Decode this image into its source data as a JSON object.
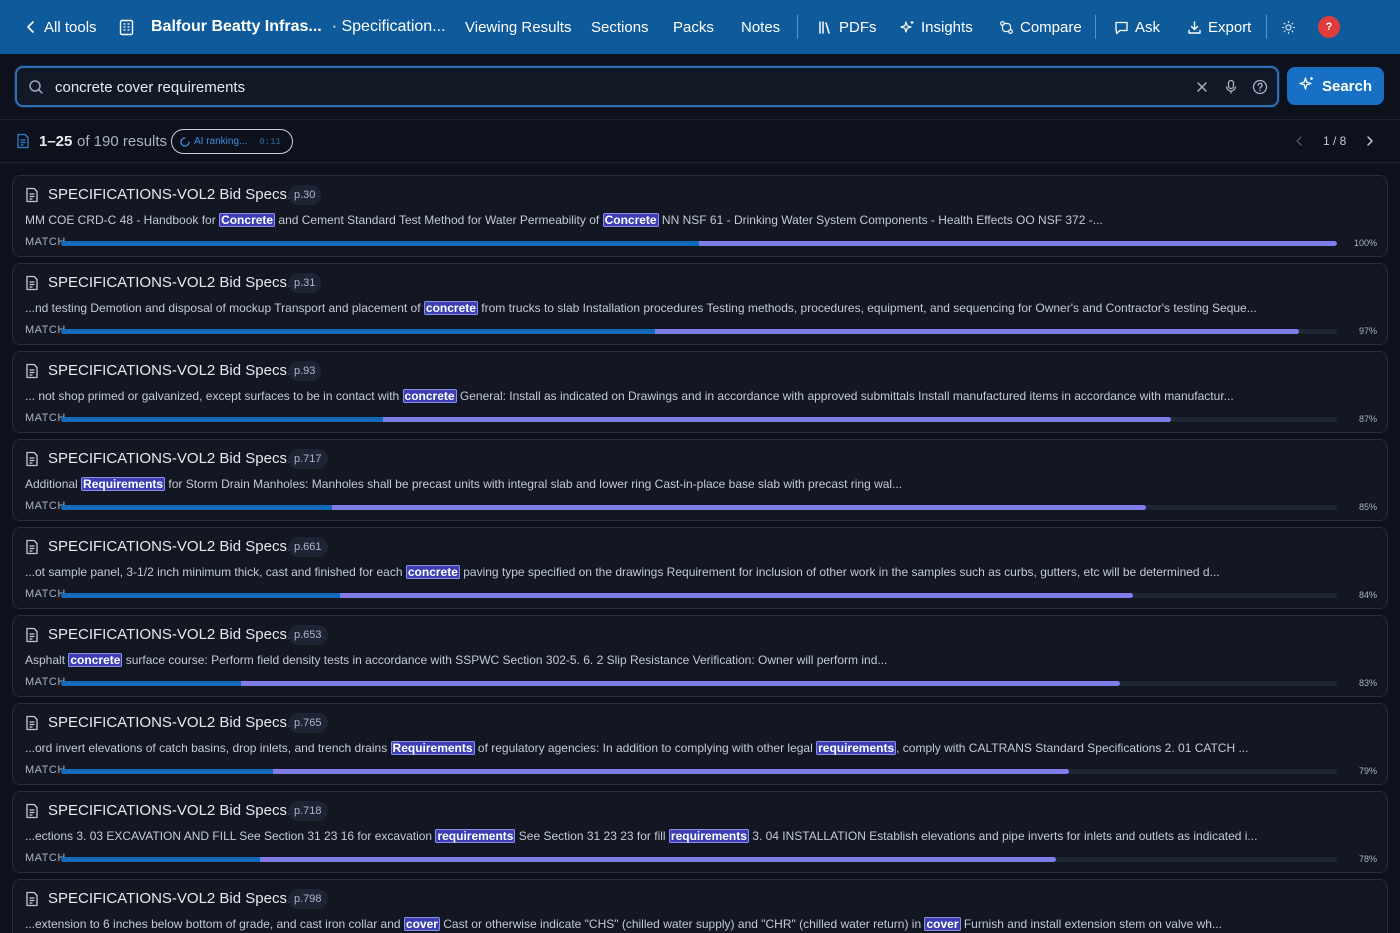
{
  "topbar": {
    "back_label": "All tools",
    "project_title": "Balfour Beatty Infras...",
    "project_subtitle": "· Specification...",
    "nav": [
      {
        "label": "Viewing Results"
      },
      {
        "label": "Sections"
      },
      {
        "label": "Packs"
      },
      {
        "label": "Notes"
      },
      {
        "label": "PDFs"
      },
      {
        "label": "Insights"
      },
      {
        "label": "Compare"
      },
      {
        "label": "Ask"
      },
      {
        "label": "Export"
      }
    ],
    "avatar_text": "?",
    "colors": {
      "bar": "#0f5a9a",
      "avatar": "#e03c3c"
    }
  },
  "search": {
    "value": "concrete cover requirements",
    "placeholder": "",
    "button_label": "Search"
  },
  "results_header": {
    "range": "1–25",
    "of_text": "of 190 results",
    "ai_label": "AI ranking...",
    "ai_timer": "0:11",
    "pager": "1 / 8"
  },
  "results": [
    {
      "file": "SPECIFICATIONS-VOL2 Bid Specs.pdf",
      "page": "p.30",
      "match_label": "MATCH",
      "snippet": [
        {
          "t": "MM COE CRD-C 48 - Handbook for "
        },
        {
          "t": "Concrete",
          "h": true
        },
        {
          "t": " and Cement Standard Test Method for Water Permeability of "
        },
        {
          "t": "Concrete",
          "h": true
        },
        {
          "t": " NN NSF 61 - Drinking Water System Components - Health Effects OO NSF 372 -..."
        }
      ],
      "match": 1.0,
      "split": 0.5,
      "pct": "100%"
    },
    {
      "file": "SPECIFICATIONS-VOL2 Bid Specs.pdf",
      "page": "p.31",
      "match_label": "MATCH",
      "snippet": [
        {
          "t": "...nd testing Demotion and disposal of mockup Transport and placement of "
        },
        {
          "t": "concrete",
          "h": true
        },
        {
          "t": " from trucks to slab Installation procedures Testing methods, procedures, equipment, and sequencing for Owner's and Contractor's testing Seque..."
        }
      ],
      "match": 0.97,
      "split": 0.48,
      "pct": "97%"
    },
    {
      "file": "SPECIFICATIONS-VOL2 Bid Specs.pdf",
      "page": "p.93",
      "match_label": "MATCH",
      "snippet": [
        {
          "t": "... not shop primed or galvanized, except surfaces to be in contact with "
        },
        {
          "t": "concrete",
          "h": true
        },
        {
          "t": " General: Install as indicated on Drawings and in accordance with approved submittals Install manufactured items in accordance with manufactur..."
        }
      ],
      "match": 0.87,
      "split": 0.29,
      "pct": "87%"
    },
    {
      "file": "SPECIFICATIONS-VOL2 Bid Specs.pdf",
      "page": "p.717",
      "match_label": "MATCH",
      "snippet": [
        {
          "t": "Additional "
        },
        {
          "t": "Requirements",
          "h": true
        },
        {
          "t": " for Storm Drain Manholes: Manholes shall be precast units with integral slab and lower ring Cast-in-place base slab with precast ring wal..."
        }
      ],
      "match": 0.85,
      "split": 0.25,
      "pct": "85%"
    },
    {
      "file": "SPECIFICATIONS-VOL2 Bid Specs.pdf",
      "page": "p.661",
      "match_label": "MATCH",
      "snippet": [
        {
          "t": "...ot sample panel, 3-1/2 inch minimum thick, cast and finished for each "
        },
        {
          "t": "concrete",
          "h": true
        },
        {
          "t": " paving type specified on the drawings Requirement for inclusion of other work in the samples such as curbs, gutters, etc will be determined d..."
        }
      ],
      "match": 0.84,
      "split": 0.26,
      "pct": "84%"
    },
    {
      "file": "SPECIFICATIONS-VOL2 Bid Specs.pdf",
      "page": "p.653",
      "match_label": "MATCH",
      "snippet": [
        {
          "t": "Asphalt "
        },
        {
          "t": "concrete",
          "h": true
        },
        {
          "t": " surface course: Perform field density tests in accordance with SSPWC Section 302-5. 6. 2 Slip Resistance Verification: Owner will perform ind..."
        }
      ],
      "match": 0.83,
      "split": 0.17,
      "pct": "83%"
    },
    {
      "file": "SPECIFICATIONS-VOL2 Bid Specs.pdf",
      "page": "p.765",
      "match_label": "MATCH",
      "snippet": [
        {
          "t": "...ord invert elevations of catch basins, drop inlets, and trench drains "
        },
        {
          "t": "Requirements",
          "h": true
        },
        {
          "t": " of regulatory agencies: In addition to complying with other legal "
        },
        {
          "t": "requirements",
          "h": true
        },
        {
          "t": ", comply with CALTRANS Standard Specifications 2. 01 CATCH ..."
        }
      ],
      "match": 0.79,
      "split": 0.21,
      "pct": "79%"
    },
    {
      "file": "SPECIFICATIONS-VOL2 Bid Specs.pdf",
      "page": "p.718",
      "match_label": "MATCH",
      "snippet": [
        {
          "t": "...ections 3. 03 EXCAVATION AND FILL See Section 31 23 16 for excavation "
        },
        {
          "t": "requirements",
          "h": true
        },
        {
          "t": " See Section 31 23 23 for fill "
        },
        {
          "t": "requirements",
          "h": true
        },
        {
          "t": " 3. 04 INSTALLATION Establish elevations and pipe inverts for inlets and outlets as indicated i..."
        }
      ],
      "match": 0.78,
      "split": 0.2,
      "pct": "78%"
    },
    {
      "file": "SPECIFICATIONS-VOL2 Bid Specs.pdf",
      "page": "p.798",
      "match_label": "MATCH",
      "snippet": [
        {
          "t": "...extension to 6 inches below bottom of grade, and cast iron collar and "
        },
        {
          "t": "cover",
          "h": true
        },
        {
          "t": " Cast or otherwise indicate \"CHS\" (chilled water supply) and \"CHR\" (chilled water return) in "
        },
        {
          "t": "cover",
          "h": true
        },
        {
          "t": " Furnish and install extension stem on valve wh..."
        }
      ],
      "match": 0.77,
      "split": 0.2,
      "pct": "77%"
    }
  ]
}
